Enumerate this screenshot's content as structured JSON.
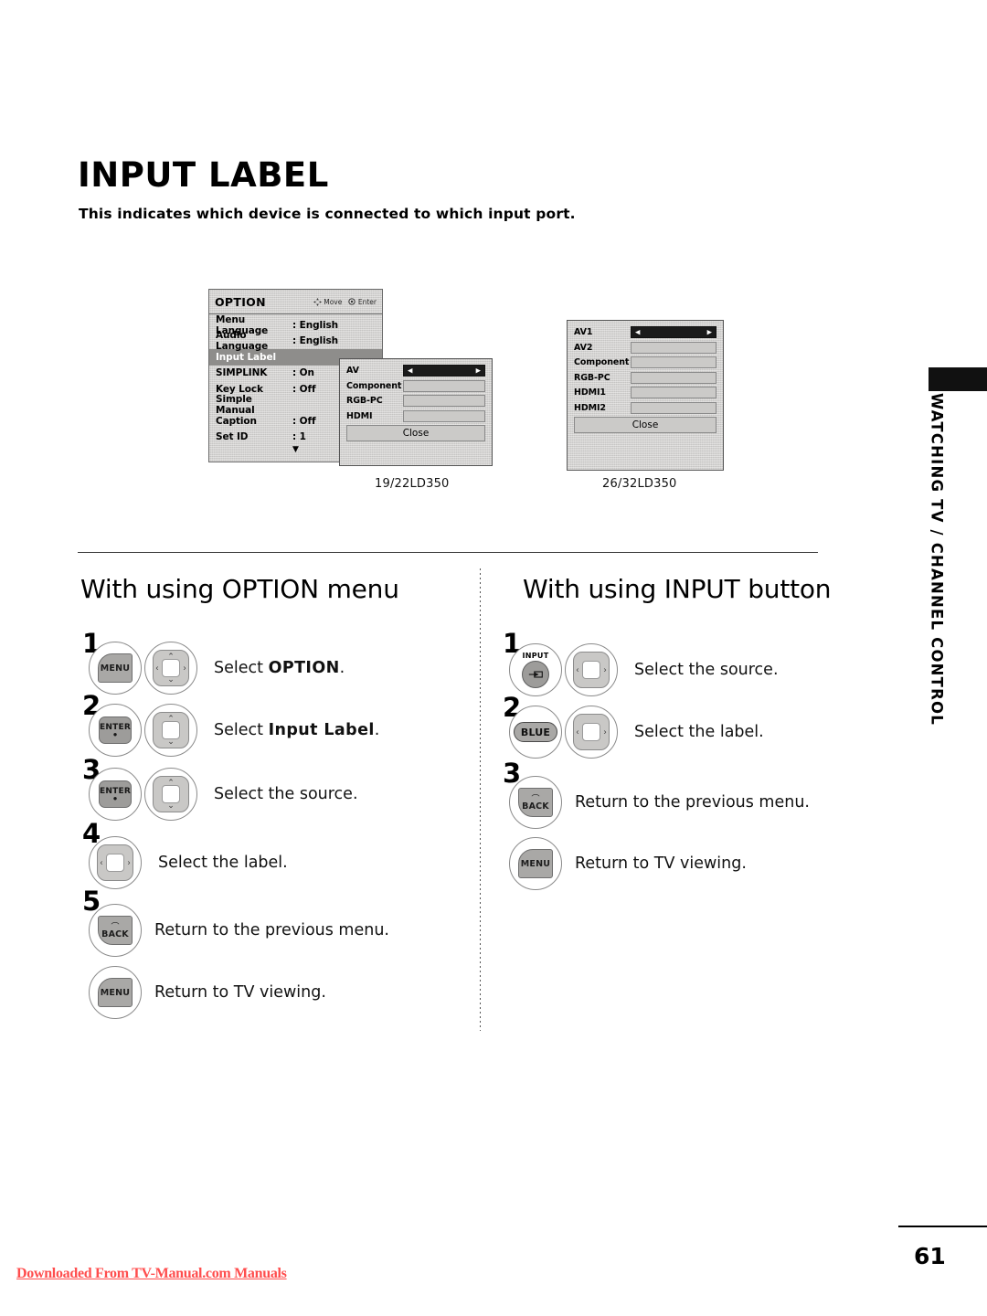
{
  "document": {
    "title": "INPUT LABEL",
    "subtitle": "This indicates which device is connected to which input port.",
    "page_number": "61",
    "side_tab": "WATCHING TV / CHANNEL CONTROL",
    "download_note": "Downloaded From TV-Manual.com Manuals"
  },
  "osd_option": {
    "panel_title": "OPTION",
    "hint_move": "Move",
    "hint_enter": "Enter",
    "rows": [
      {
        "key": "Menu Language",
        "value": ": English",
        "selected": false
      },
      {
        "key": "Audio Language",
        "value": ": English",
        "selected": false
      },
      {
        "key": "Input Label",
        "value": "",
        "selected": true
      },
      {
        "key": "SIMPLINK",
        "value": ": On",
        "selected": false
      },
      {
        "key": "Key Lock",
        "value": ": Off",
        "selected": false
      },
      {
        "key": "Simple Manual",
        "value": "",
        "selected": false
      },
      {
        "key": "Caption",
        "value": ": Off",
        "selected": false
      },
      {
        "key": "Set ID",
        "value": ": 1",
        "selected": false
      }
    ],
    "scroll_indicator": "▼"
  },
  "osd_av_small": {
    "model_caption": "19/22LD350",
    "close_label": "Close",
    "sources": [
      {
        "name": "AV",
        "active": true
      },
      {
        "name": "Component",
        "active": false
      },
      {
        "name": "RGB-PC",
        "active": false
      },
      {
        "name": "HDMI",
        "active": false
      }
    ]
  },
  "osd_av_large": {
    "model_caption": "26/32LD350",
    "close_label": "Close",
    "sources": [
      {
        "name": "AV1",
        "active": true
      },
      {
        "name": "AV2",
        "active": false
      },
      {
        "name": "Component",
        "active": false
      },
      {
        "name": "RGB-PC",
        "active": false
      },
      {
        "name": "HDMI1",
        "active": false
      },
      {
        "name": "HDMI2",
        "active": false
      }
    ]
  },
  "column_left": {
    "heading": "With using OPTION menu",
    "steps": [
      {
        "number": "1",
        "keys": [
          "MENU"
        ],
        "pad": "4way",
        "text_plain": "Select ",
        "text_bold": "OPTION",
        "text_tail": "."
      },
      {
        "number": "2",
        "keys": [
          "ENTER"
        ],
        "pad": "updown",
        "text_plain": "Select ",
        "text_bold": "Input Label",
        "text_tail": "."
      },
      {
        "number": "3",
        "keys": [
          "ENTER"
        ],
        "pad": "updown",
        "text_plain": "Select the source.",
        "text_bold": "",
        "text_tail": ""
      },
      {
        "number": "4",
        "keys": [],
        "pad": "leftright",
        "text_plain": "Select the label.",
        "text_bold": "",
        "text_tail": ""
      },
      {
        "number": "5",
        "keys": [
          "BACK"
        ],
        "pad": "none",
        "text_plain": "Return to the previous menu.",
        "text_bold": "",
        "text_tail": ""
      },
      {
        "number": "",
        "keys": [
          "MENU"
        ],
        "pad": "none",
        "text_plain": "Return to TV viewing.",
        "text_bold": "",
        "text_tail": ""
      }
    ]
  },
  "column_right": {
    "heading": "With using INPUT button",
    "steps": [
      {
        "number": "1",
        "keys": [
          "INPUT"
        ],
        "pad": "leftright",
        "text_plain": "Select the source.",
        "text_bold": "",
        "text_tail": ""
      },
      {
        "number": "2",
        "keys": [
          "BLUE"
        ],
        "pad": "leftright",
        "text_plain": "Select the label.",
        "text_bold": "",
        "text_tail": ""
      },
      {
        "number": "3",
        "keys": [
          "BACK"
        ],
        "pad": "none",
        "text_plain": "Return to the previous menu.",
        "text_bold": "",
        "text_tail": ""
      },
      {
        "number": "",
        "keys": [
          "MENU"
        ],
        "pad": "none",
        "text_plain": "Return to TV viewing.",
        "text_bold": "",
        "text_tail": ""
      }
    ]
  },
  "key_labels": {
    "menu": "MENU",
    "enter": "ENTER",
    "back": "BACK",
    "input": "INPUT",
    "blue": "BLUE"
  },
  "colors": {
    "osd_bg": "#d3d2d0",
    "osd_selected": "#8e8d8b",
    "osd_active_box": "#1b1b1b",
    "key_face": "#a9a8a6",
    "download_link": "#ff4d4d"
  }
}
